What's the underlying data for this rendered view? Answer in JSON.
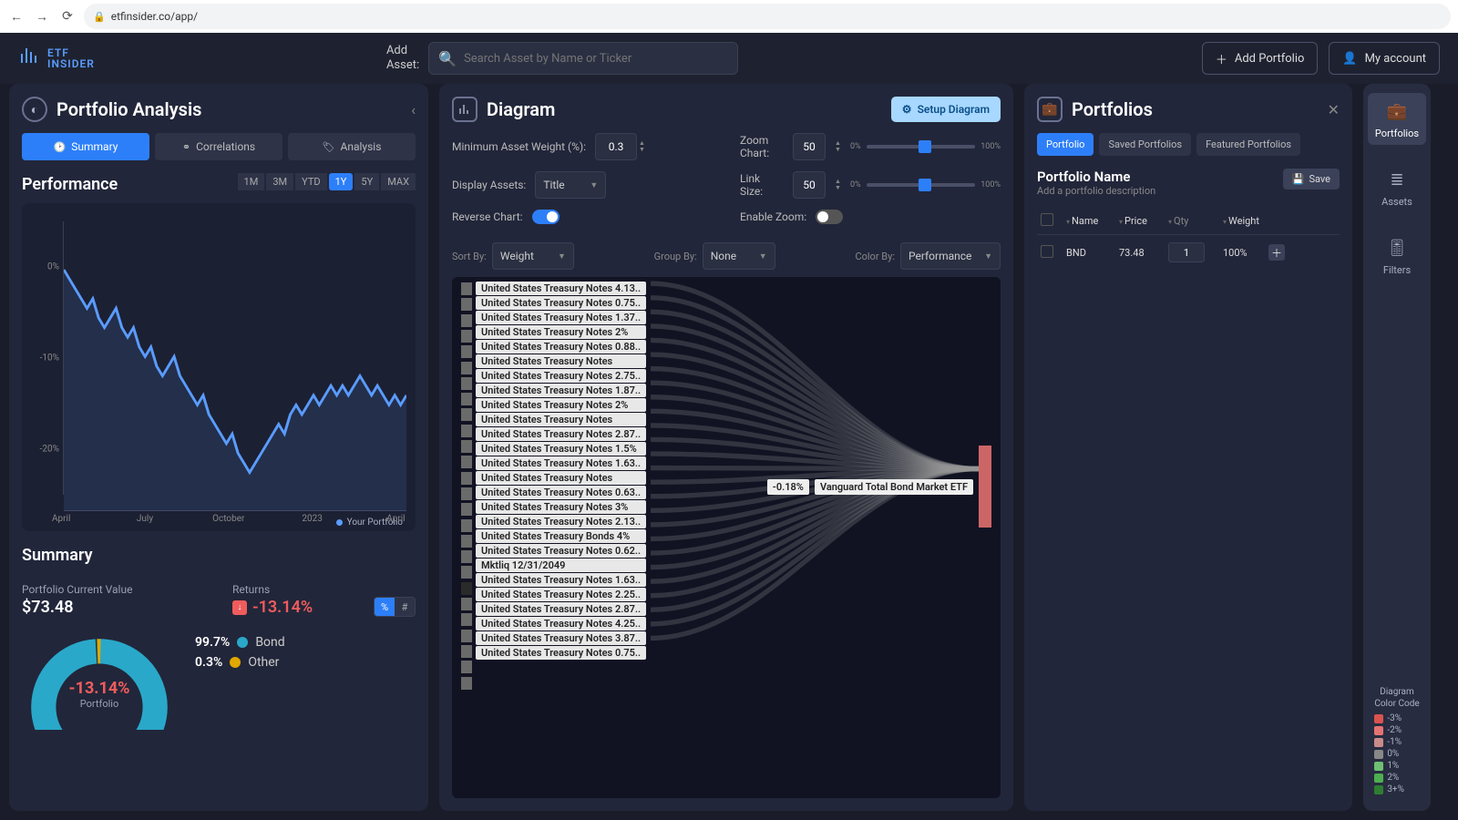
{
  "browser": {
    "url": "etfinsider.co/app/"
  },
  "logo": {
    "line1": "ETF",
    "line2": "INSIDER"
  },
  "topbar": {
    "add_asset_label": "Add\nAsset:",
    "search_placeholder": "Search Asset by Name or Ticker",
    "add_portfolio": "Add Portfolio",
    "my_account": "My account"
  },
  "analysis": {
    "title": "Portfolio Analysis",
    "tabs": {
      "summary": "Summary",
      "correlations": "Correlations",
      "analysis": "Analysis"
    },
    "performance": {
      "title": "Performance",
      "ranges": [
        "1M",
        "3M",
        "YTD",
        "1Y",
        "5Y",
        "MAX"
      ],
      "active_range": "1Y",
      "legend": "Your Portfolio"
    },
    "summary": {
      "title": "Summary",
      "value_label": "Portfolio Current Value",
      "value": "$73.48",
      "returns_label": "Returns",
      "returns": "-13.14%",
      "alloc": [
        {
          "pct": "99.7%",
          "name": "Bond",
          "color": "#2aa8c9"
        },
        {
          "pct": "0.3%",
          "name": "Other",
          "color": "#e0a800"
        }
      ],
      "donut_center": "-13.14%",
      "donut_sub": "Portfolio"
    }
  },
  "diagram": {
    "title": "Diagram",
    "setup_btn": "Setup Diagram",
    "controls": {
      "min_weight_label": "Minimum Asset Weight (%):",
      "min_weight_value": "0.3",
      "display_label": "Display Assets:",
      "display_value": "Title",
      "reverse_label": "Reverse Chart:",
      "zoom_label": "Zoom Chart:",
      "zoom_value": "50",
      "link_label": "Link Size:",
      "link_value": "50",
      "enable_zoom_label": "Enable Zoom:"
    },
    "sortbar": {
      "sort_label": "Sort By:",
      "sort_value": "Weight",
      "group_label": "Group By:",
      "group_value": "None",
      "color_label": "Color By:",
      "color_value": "Performance"
    },
    "left_items": [
      "United States Treasury Notes 4.13..",
      "United States Treasury Notes 0.75..",
      "United States Treasury Notes 1.37..",
      "United States Treasury Notes 2%",
      "United States Treasury Notes 0.88..",
      "United States Treasury Notes",
      "United States Treasury Notes 2.75..",
      "United States Treasury Notes 1.87..",
      "United States Treasury Notes 2%",
      "United States Treasury Notes",
      "United States Treasury Notes 2.87..",
      "United States Treasury Notes 1.5%",
      "United States Treasury Notes 1.63..",
      "United States Treasury Notes",
      "United States Treasury Notes 0.63..",
      "United States Treasury Notes 3%",
      "United States Treasury Notes 2.13..",
      "United States Treasury Bonds 4%",
      "United States Treasury Notes 0.62..",
      "Mktliq 12/31/2049",
      "United States Treasury Notes 1.63..",
      "United States Treasury Notes 2.25..",
      "United States Treasury Notes 2.87..",
      "United States Treasury Notes 4.25..",
      "United States Treasury Notes 3.87..",
      "United States Treasury Notes 0.75.."
    ],
    "right_badge": "-0.18%",
    "right_label": "Vanguard Total Bond Market ETF"
  },
  "portfolios": {
    "title": "Portfolios",
    "tabs": {
      "portfolio": "Portfolio",
      "saved": "Saved Portfolios",
      "featured": "Featured Portfolios"
    },
    "name": "Portfolio Name",
    "desc": "Add a portfolio description",
    "save": "Save",
    "columns": {
      "name": "Name",
      "price": "Price",
      "qty": "Qty",
      "weight": "Weight"
    },
    "row": {
      "name": "BND",
      "price": "73.48",
      "qty": "1",
      "weight": "100%"
    }
  },
  "rail": {
    "items": [
      {
        "label": "Portfolios",
        "ico": "briefcase"
      },
      {
        "label": "Assets",
        "ico": "list"
      },
      {
        "label": "Filters",
        "ico": "sliders"
      }
    ],
    "legend_title": "Diagram Color Code",
    "legend": [
      {
        "c": "#d9534f",
        "t": "-3%"
      },
      {
        "c": "#e57373",
        "t": "-2%"
      },
      {
        "c": "#c98a8a",
        "t": "-1%"
      },
      {
        "c": "#888",
        "t": "0%"
      },
      {
        "c": "#6fbf73",
        "t": "1%"
      },
      {
        "c": "#4caf50",
        "t": "2%"
      },
      {
        "c": "#2e7d32",
        "t": "3+%"
      }
    ]
  },
  "chart_data": {
    "type": "line",
    "title": "Performance",
    "ylabel": "%",
    "ylim": [
      -25,
      5
    ],
    "y_ticks": [
      0,
      -10,
      -20
    ],
    "x_ticks": [
      "April",
      "July",
      "October",
      "2023",
      "April"
    ],
    "series": [
      {
        "name": "Your Portfolio",
        "values": [
          0,
          -1,
          -2,
          -3,
          -4,
          -3,
          -5,
          -6,
          -5,
          -4,
          -6,
          -7,
          -6,
          -8,
          -9,
          -8,
          -10,
          -11,
          -10,
          -9,
          -11,
          -12,
          -13,
          -14,
          -13,
          -15,
          -16,
          -17,
          -18,
          -17,
          -19,
          -20,
          -21,
          -20,
          -19,
          -18,
          -17,
          -16,
          -17,
          -15,
          -14,
          -15,
          -14,
          -13,
          -14,
          -13,
          -12,
          -13,
          -12,
          -13,
          -12,
          -11,
          -12,
          -13,
          -12,
          -13,
          -14,
          -13,
          -14,
          -13
        ]
      }
    ]
  }
}
